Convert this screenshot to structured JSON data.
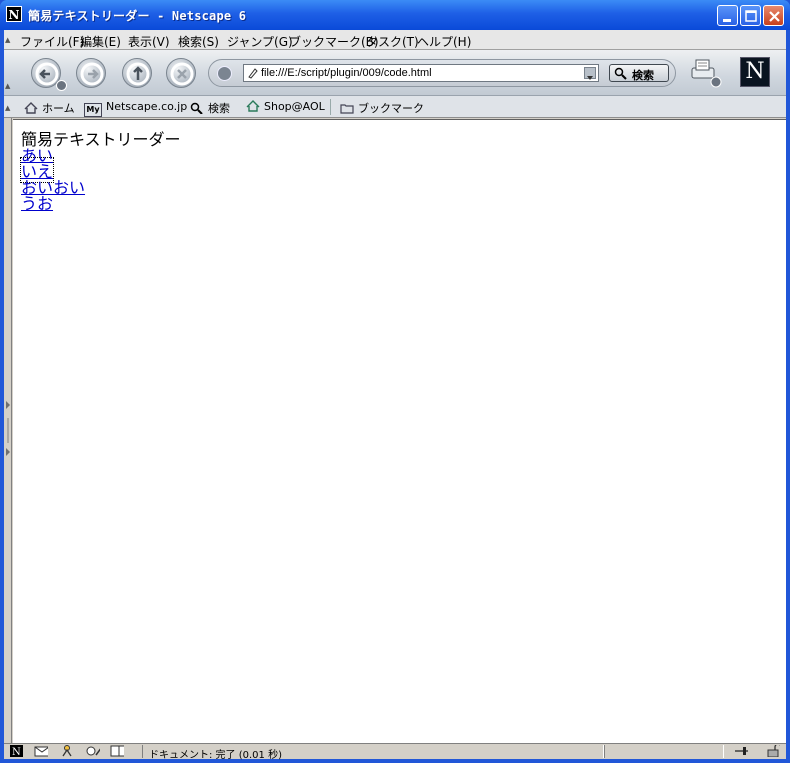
{
  "window": {
    "title": "簡易テキストリーダー - Netscape 6",
    "app_letter": "N"
  },
  "menu": [
    "ファイル(F)",
    "編集(E)",
    "表示(V)",
    "検索(S)",
    "ジャンプ(G)",
    "ブックマーク(B)",
    "タスク(T)",
    "ヘルプ(H)"
  ],
  "nav": {
    "url": "file:///E:/script/plugin/009/code.html",
    "search_label": "検索",
    "logo_letter": "N"
  },
  "bookmarks": {
    "home": "ホーム",
    "my_badge": "My",
    "netscape": "Netscape.co.jp",
    "search": "検索",
    "shop": "Shop@AOL",
    "bookmarks": "ブックマーク"
  },
  "page": {
    "heading": "簡易テキストリーダー",
    "links": [
      "あい",
      "いえ",
      "おいおい",
      "うお"
    ]
  },
  "status": {
    "text": "ドキュメント: 完了 (0.01 秒)"
  }
}
